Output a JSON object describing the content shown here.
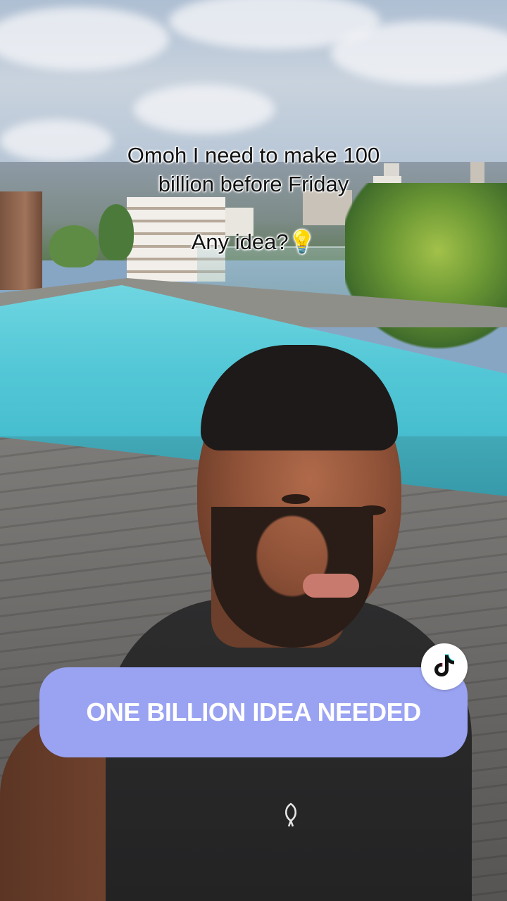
{
  "caption": {
    "line1": "Omoh I need to make 100",
    "line2": "billion before Friday",
    "line3": "Any idea?💡"
  },
  "banner": {
    "text": "ONE BILLION IDEA NEEDED",
    "color": "#9aa3f2"
  },
  "badge": {
    "icon": "tiktok-icon"
  }
}
